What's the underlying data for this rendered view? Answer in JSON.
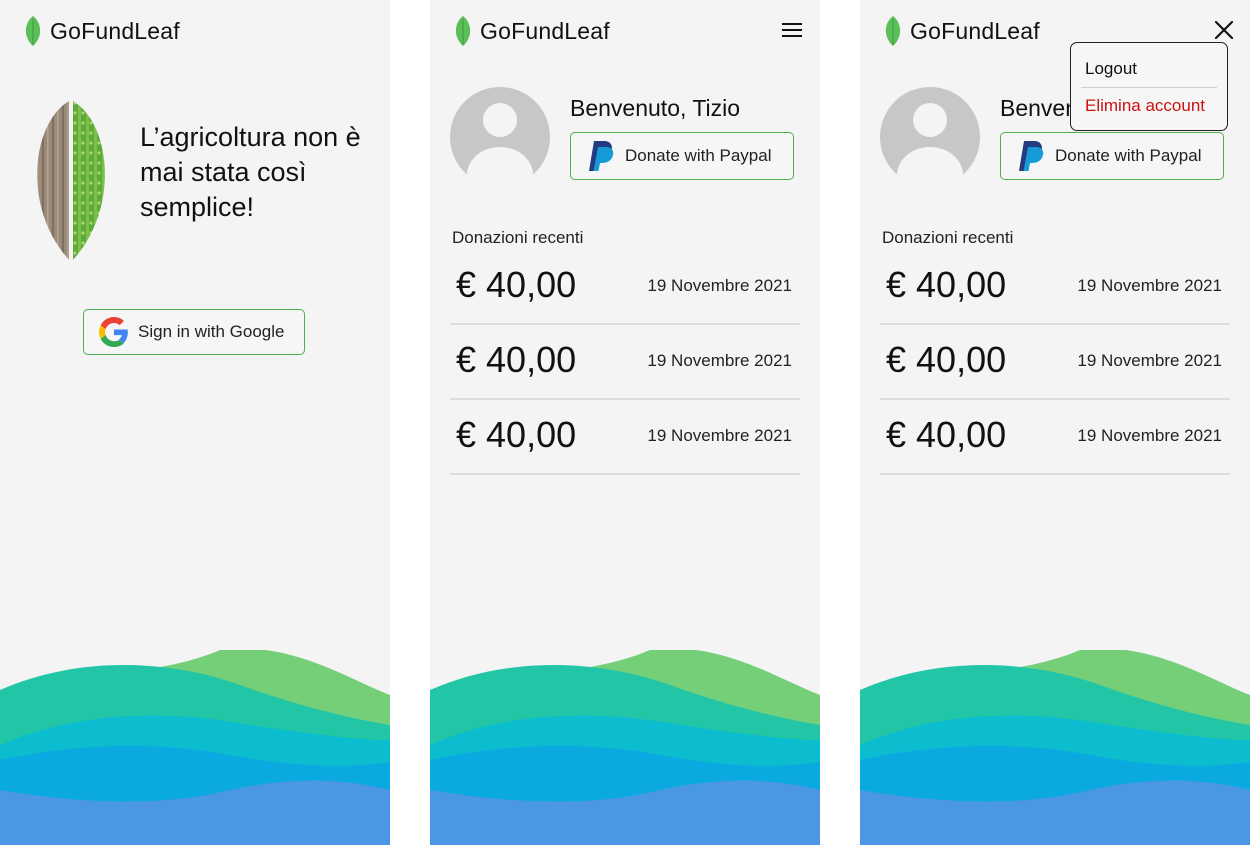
{
  "app": {
    "name": "GoFundLeaf"
  },
  "icons": {
    "logo": "leaf-icon",
    "menu": "hamburger-menu-icon",
    "close": "close-icon",
    "google": "google-g-icon",
    "paypal": "paypal-icon",
    "avatar": "user-avatar-placeholder"
  },
  "colors": {
    "accent_green": "#4caf50",
    "leaf_green": "#5bbf5a",
    "danger_red": "#cc1111",
    "wave_1": "#74cf78",
    "wave_2": "#22c6a6",
    "wave_3": "#0bbdcf",
    "wave_4": "#0aa9df",
    "wave_5": "#4a98e3"
  },
  "login": {
    "tagline": "L’agricoltura non è mai stata così semplice!",
    "google_button": "Sign in with Google"
  },
  "dashboard": {
    "welcome": "Benvenuto, Tizio",
    "welcome_truncated": "Benvenuto, Tizio",
    "paypal_button": "Donate with Paypal",
    "recent_title": "Donazioni recenti",
    "donations": [
      {
        "amount": "€ 40,00",
        "date": "19 Novembre 2021"
      },
      {
        "amount": "€ 40,00",
        "date": "19 Novembre 2021"
      },
      {
        "amount": "€ 40,00",
        "date": "19 Novembre 2021"
      }
    ]
  },
  "menu": {
    "logout": "Logout",
    "delete_account": "Elimina account"
  }
}
